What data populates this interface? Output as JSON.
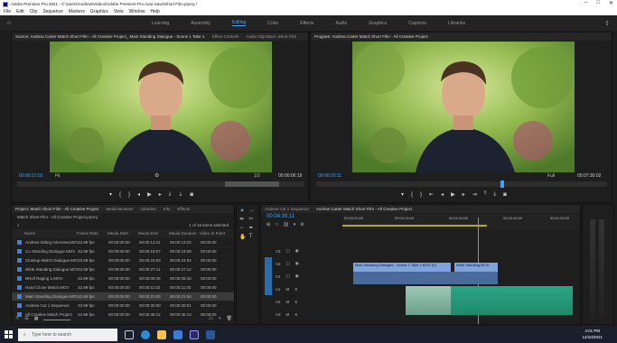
{
  "titlebar": {
    "title": "Adobe Premiere Pro 2021 - C:\\Users\\Andrew\\Videos\\Adobe Premiere Pro Auto-Save\\Short Film.prproj *",
    "win_min": "–",
    "win_max": "□",
    "win_close": "✕"
  },
  "menu": [
    "File",
    "Edit",
    "Clip",
    "Sequence",
    "Markers",
    "Graphics",
    "View",
    "Window",
    "Help"
  ],
  "workspaces": [
    "Learning",
    "Assembly",
    "Editing",
    "Color",
    "Effects",
    "Audio",
    "Graphics",
    "Captions",
    "Libraries"
  ],
  "workspace_active": "Editing",
  "source": {
    "tabs": [
      "Source: Andrew Carter Match Short Film - All Creative Project_ Main Standing Dialogue - Scene 1 Take 1.MOV: 00:00:00:00",
      "Effect Controls",
      "Audio Clip Mixer: Short Film"
    ],
    "tc_left": "00:00:21:03",
    "fit": "Fit",
    "tc_right": "00:00:06:19",
    "res": "1/2"
  },
  "program": {
    "tabs": [
      "Program: Andrew Carter Match Short Film - All Creative Project"
    ],
    "tc_left": "00:00:29:11",
    "fit": "Full",
    "tc_right": "00:07:30:02"
  },
  "project": {
    "tabs": [
      "Project: Match Short Film - All Creative Project",
      "Media Browser",
      "Libraries",
      "Info",
      "Effects"
    ],
    "path": "Match Short Film - All Creative Project.prproj",
    "count": "1 of 16 items selected",
    "headers": [
      "Name",
      "Frame Rate",
      "Media Start",
      "Media End",
      "Media Duration",
      "Video In Point"
    ],
    "rows": [
      [
        "Andrew Sitting Interview.MOV",
        "23.98 fps",
        "00:00:00:00",
        "00:00:13:21",
        "00:00:13:22",
        "00:00:00"
      ],
      [
        "Cu Standing Dialogue.MOV",
        "23.98 fps",
        "00:00:00:00",
        "00:00:19:07",
        "00:00:19:08",
        "00:00:00"
      ],
      [
        "Closeup Match Dialogue.MOV",
        "23.98 fps",
        "00:00:00:00",
        "00:00:24:03",
        "00:00:24:04",
        "00:00:00"
      ],
      [
        "Wide Standing Dialogue.MOV",
        "23.98 fps",
        "00:00:00:00",
        "00:00:27:11",
        "00:00:27:12",
        "00:00:00"
      ],
      [
        "BRoll Raging 1.MOV",
        "23.98 fps",
        "00:00:00:00",
        "00:00:09:15",
        "00:00:09:16",
        "00:00:00"
      ],
      [
        "Hand Close Match.MOV",
        "23.98 fps",
        "00:00:00:00",
        "00:00:11:02",
        "00:00:11:03",
        "00:00:00"
      ],
      [
        "Main Standing Dialogue.MOV",
        "23.98 fps",
        "00:00:00:00",
        "00:00:21:03",
        "00:00:21:04",
        "00:00:00"
      ],
      [
        "Andrew Cut 1 Sequence",
        "23.98 fps",
        "00:00:00:00",
        "00:00:30:00",
        "00:00:30:01",
        "00:00:00"
      ],
      [
        "All Creative Match Project",
        "23.98 fps",
        "00:00:00:00",
        "00:00:45:12",
        "00:00:45:13",
        "00:00:00"
      ]
    ]
  },
  "timeline": {
    "tabs": [
      "Andrew Cut 1 Sequence",
      "Andrew Carter Match Short Film - All Creative Project"
    ],
    "tc": "00:04:39:11",
    "ruler": [
      "00:00:00:00",
      "00:00:15:00",
      "00:00:30:00",
      "00:00:45:00",
      "00:01:00:00"
    ],
    "tracks": [
      "V3",
      "V2",
      "V1",
      "A1",
      "A2",
      "A3"
    ],
    "clip_v1": "Main Standing Dialogue - Scene 1 Take 1.MOV [V]",
    "clip_v1b": "Wide Standing.MOV",
    "clip_a1": "Audio"
  },
  "taskbar": {
    "search_placeholder": "Type here to search",
    "time": "4:01 PM",
    "date": "12/10/2021"
  }
}
